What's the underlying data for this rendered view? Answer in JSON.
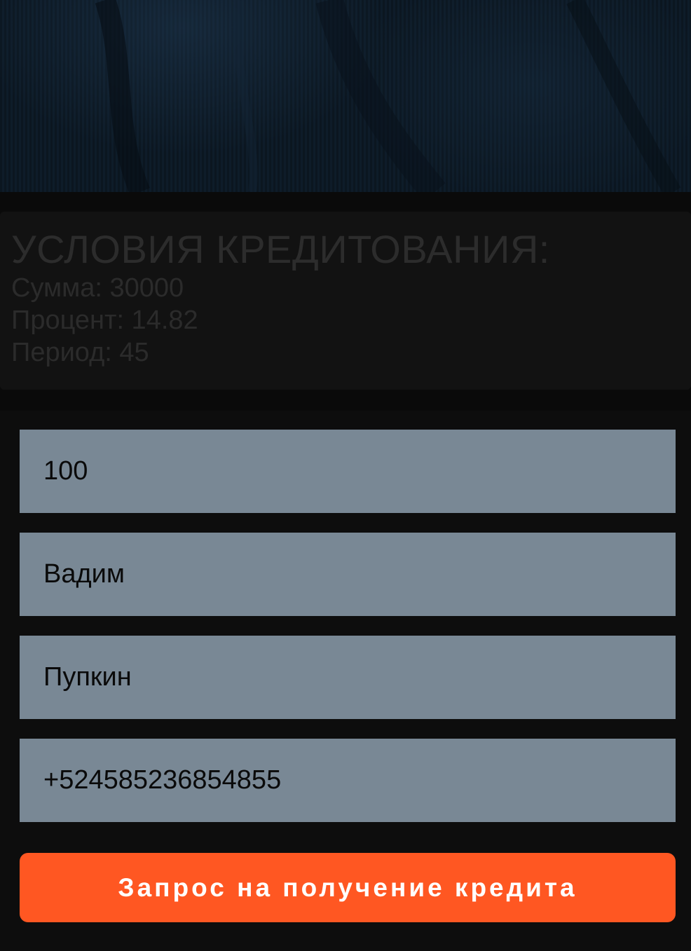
{
  "conditions": {
    "title": "УСЛОВИЯ КРЕДИТОВАНИЯ:",
    "sum": "Сумма: 30000",
    "percent": "Процент: 14.82",
    "period": "Период: 45"
  },
  "form": {
    "amount_value": "100",
    "first_name_value": "Вадим",
    "last_name_value": "Пупкин",
    "phone_value": "+524585236854855",
    "submit_label": "Запрос на получение кредита"
  },
  "colors": {
    "background": "#0a0a0a",
    "field": "#798895",
    "accent": "#ff5722"
  }
}
